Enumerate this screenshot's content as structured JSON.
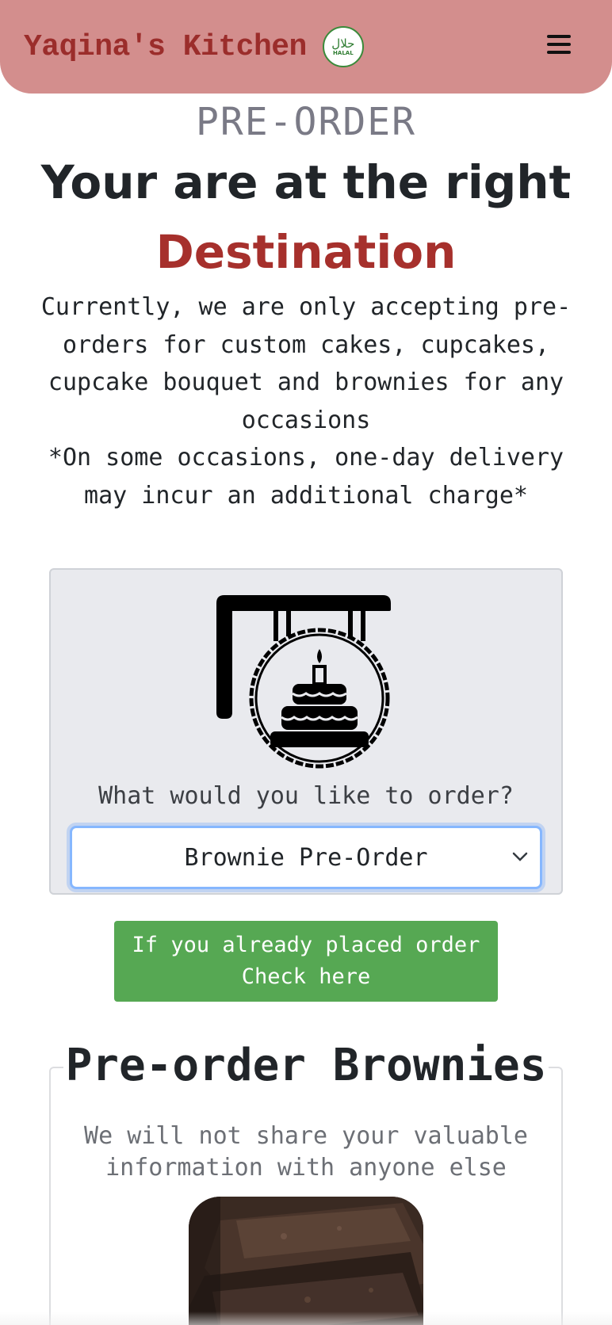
{
  "navbar": {
    "brand": "Yaqina's Kitchen",
    "halal_badge": {
      "arabic": "حلال",
      "latin": "HALAL"
    },
    "menu_icon": "hamburger-icon",
    "brand_color": "#9b2d2b",
    "background_color": "#d38e8d"
  },
  "hero": {
    "eyebrow": "PRE-ORDER",
    "headline": "Your are at the right",
    "headline_accent": "Destination",
    "accent_color": "#a6302c",
    "intro_line_1": "Currently, we are only accepting pre-orders for custom cakes, cupcakes, cupcake bouquet and brownies for any occasions",
    "intro_line_2": "*On some occasions, one-day delivery may incur an additional charge*"
  },
  "order_card": {
    "icon": "cake-shop-sign-icon",
    "prompt": "What would you like to order?",
    "selected_option": "Brownie Pre-Order"
  },
  "check_order_button": {
    "line_1": "If you already placed order",
    "line_2": "Check here",
    "color": "#56a853"
  },
  "brownie_section": {
    "title": "Pre-order Brownies",
    "privacy_line_1": "We will not share your valuable",
    "privacy_line_2": "information with anyone else"
  }
}
